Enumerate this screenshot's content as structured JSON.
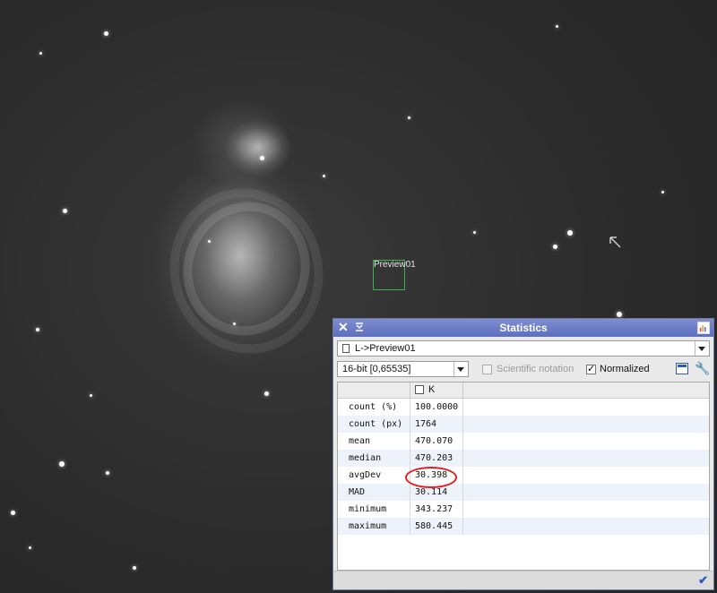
{
  "image": {
    "preview_label": "Preview01"
  },
  "window": {
    "title": "Statistics",
    "view_selector": "L->Preview01",
    "format_selector": "16-bit [0,65535]",
    "scientific_notation_label": "Scientific notation",
    "scientific_notation_checked": false,
    "normalized_label": "Normalized",
    "normalized_checked": true
  },
  "table": {
    "channel_header": "K",
    "rows": [
      {
        "name": "count (%)",
        "value": "100.0000"
      },
      {
        "name": "count (px)",
        "value": "1764"
      },
      {
        "name": "mean",
        "value": "470.070"
      },
      {
        "name": "median",
        "value": "470.203"
      },
      {
        "name": "avgDev",
        "value": "30.398"
      },
      {
        "name": "MAD",
        "value": "30.114"
      },
      {
        "name": "minimum",
        "value": "343.237"
      },
      {
        "name": "maximum",
        "value": "580.445"
      }
    ]
  },
  "colors": {
    "titlebar": "#6b7cc6",
    "highlight": "#e31d1d",
    "preview_outline": "#3fb04a"
  }
}
